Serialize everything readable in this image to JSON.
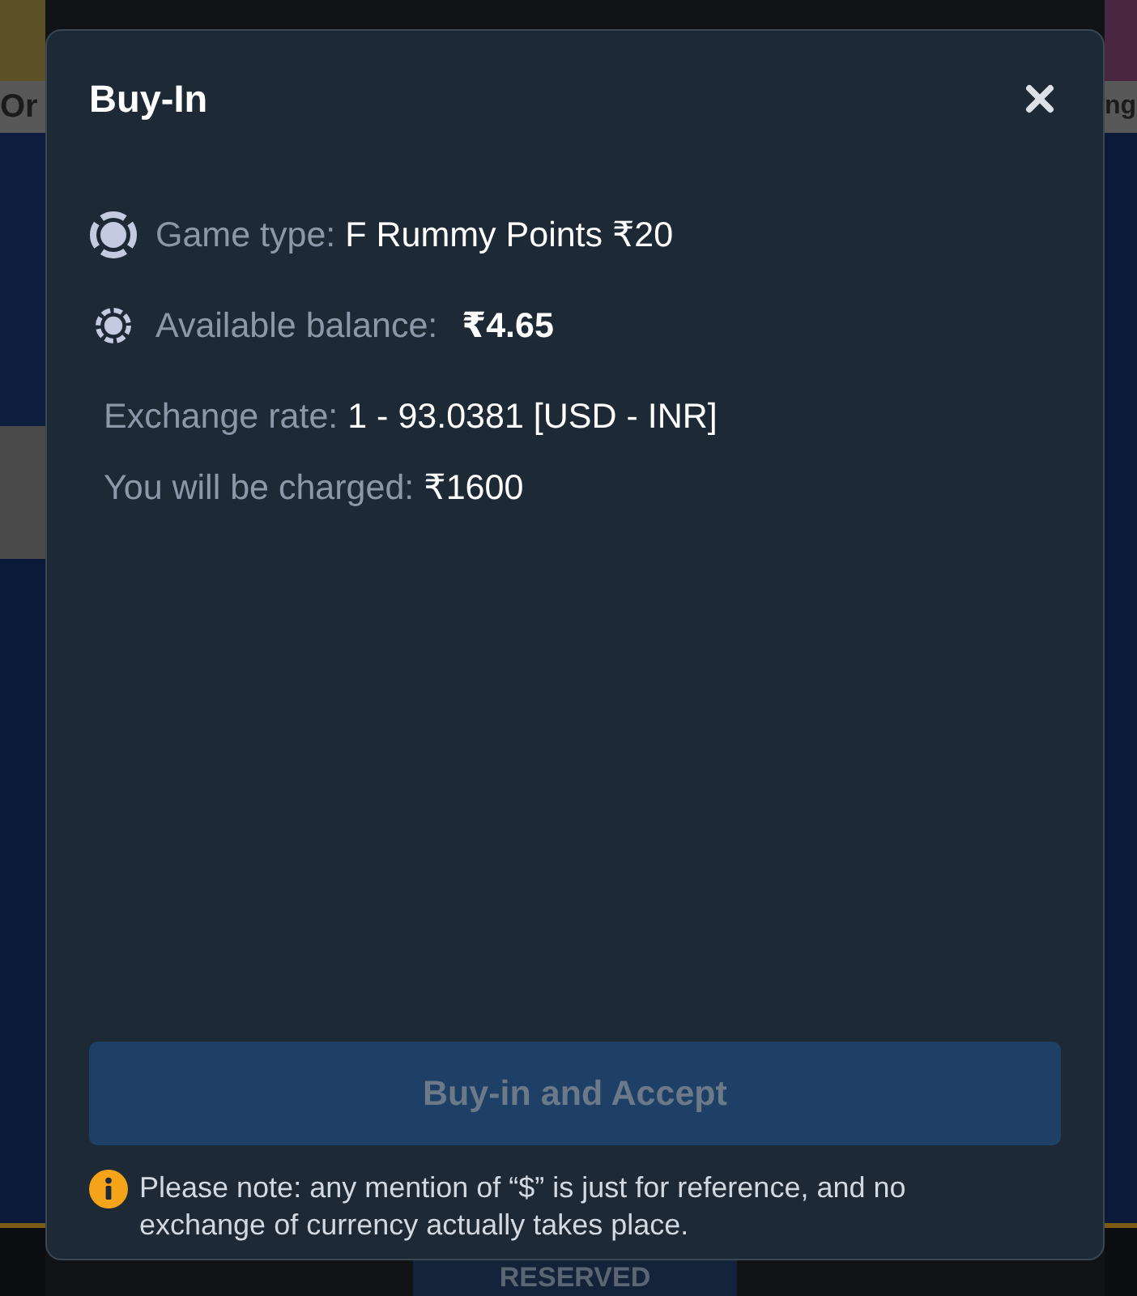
{
  "backdrop": {
    "left_card": {
      "title": "Or"
    },
    "right_card": {
      "title": "ng"
    },
    "seat": {
      "status": "RESERVED"
    }
  },
  "dialog": {
    "title": "Buy-In",
    "details": [
      {
        "kind": "game",
        "label": "Game type:",
        "value": "F Rummy Points ₹20"
      },
      {
        "kind": "balance",
        "label": "Available balance:",
        "value": "₹4.65"
      },
      {
        "kind": "plain",
        "label": "Exchange rate:",
        "value": "1 - 93.0381 [USD - INR]"
      },
      {
        "kind": "plain",
        "label": "You will be charged:",
        "value": "₹1600"
      }
    ],
    "button": {
      "label": "Buy-in and Accept",
      "disabled": true
    },
    "note": "Please note: any mention of “$” is just for reference, and no exchange of currency actually takes place."
  }
}
